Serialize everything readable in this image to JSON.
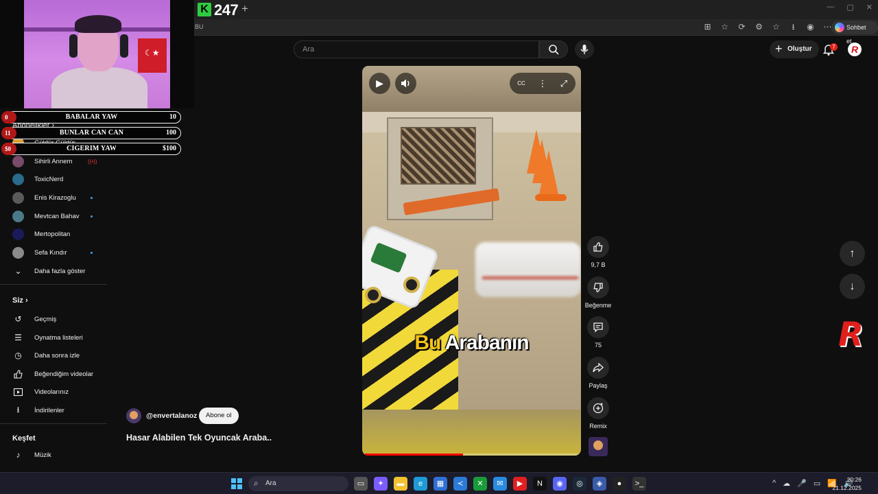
{
  "browser": {
    "tab_logo": "K",
    "tab_title": "247",
    "tab_plus": "+",
    "address_fragment": "BU",
    "chat_button": "Sohbet et",
    "window_controls": [
      "—",
      "▢",
      "✕"
    ],
    "toolbar_icons": [
      "⊞",
      "☆",
      "⟳",
      "⚙",
      "☆",
      "⭳",
      "◉",
      "⋯"
    ]
  },
  "webcam": {
    "description_hidden": ""
  },
  "scoreboard": [
    {
      "index": "0",
      "label": "BABALAR YAW",
      "value": "10"
    },
    {
      "index": "11",
      "label": "BUNLAR CAN CAN",
      "value": "100"
    },
    {
      "index": "$0",
      "label": "CIGERIM YAW",
      "value": "$100"
    }
  ],
  "header": {
    "search_placeholder": "Ara",
    "search_icon": "search-icon",
    "mic_icon": "mic-icon",
    "create_label": "Oluştur",
    "notification_count": "7",
    "avatar_letter": "R"
  },
  "sidebar": {
    "subscriptions_heading": "Abonelikler",
    "subscriptions": [
      {
        "name": "Güldür Güldür",
        "color": "#d8a03a",
        "indicator": ""
      },
      {
        "name": "Sihirli Annem",
        "color": "#7a4a6a",
        "indicator": "live"
      },
      {
        "name": "ToxicNerd",
        "color": "#2a6a8a",
        "indicator": ""
      },
      {
        "name": "Enis Kirazoglu",
        "color": "#5a5a5a",
        "indicator": "dot"
      },
      {
        "name": "Mevtcan Bahav",
        "color": "#4a7a8a",
        "indicator": "dot"
      },
      {
        "name": "Mertopolitan",
        "color": "#1a1a5a",
        "indicator": ""
      },
      {
        "name": "Sefa Kındır",
        "color": "#8a8a8a",
        "indicator": "dot"
      }
    ],
    "show_more": "Daha fazla göster",
    "you_heading": "Siz",
    "you_items": [
      {
        "label": "Geçmiş",
        "icon": "history-icon",
        "glyph": "↺"
      },
      {
        "label": "Oynatma listeleri",
        "icon": "playlist-icon",
        "glyph": "☰"
      },
      {
        "label": "Daha sonra izle",
        "icon": "clock-icon",
        "glyph": "◷"
      },
      {
        "label": "Beğendiğim videolar",
        "icon": "thumbs-up-icon",
        "glyph": "👍"
      },
      {
        "label": "Videolarınız",
        "icon": "video-icon",
        "glyph": "▶"
      },
      {
        "label": "İndirilenler",
        "icon": "download-icon",
        "glyph": "⭳"
      }
    ],
    "explore_heading": "Keşfet",
    "explore_items": [
      {
        "label": "Müzik",
        "icon": "music-icon",
        "glyph": "♪"
      }
    ]
  },
  "video": {
    "caption_highlight": "Bu",
    "caption_rest": "Arabanın",
    "progress": 0.46,
    "play_glyph": "▶",
    "volume_glyph": "🔊",
    "cc_glyph": "CC",
    "more_glyph": "⋮",
    "fullscreen_glyph": "⤢"
  },
  "actions": {
    "like_count": "9,7 B",
    "dislike_label": "Beğenme",
    "comment_count": "75",
    "share_label": "Paylaş",
    "remix_label": "Remix"
  },
  "channel": {
    "handle": "@envertalanoz",
    "subscribe_label": "Abone ol",
    "video_title": "Hasar Alabilen Tek Oyuncak Araba.."
  },
  "nav": {
    "up_glyph": "↑",
    "down_glyph": "↓"
  },
  "brand_letter": "R",
  "taskbar": {
    "search_placeholder": "Ara",
    "apps": [
      {
        "name": "task-view",
        "color": "#555",
        "glyph": "▭"
      },
      {
        "name": "copilot",
        "color": "#7a5cff",
        "glyph": "✦"
      },
      {
        "name": "file-explorer",
        "color": "#f2c230",
        "glyph": "▬"
      },
      {
        "name": "edge",
        "color": "#1e9ad6",
        "glyph": "e"
      },
      {
        "name": "store",
        "color": "#2f6fd6",
        "glyph": "▦"
      },
      {
        "name": "vs-code",
        "color": "#2b7bd6",
        "glyph": "≺"
      },
      {
        "name": "xbox",
        "color": "#1a9a3a",
        "glyph": "✕"
      },
      {
        "name": "mail",
        "color": "#2a8ae0",
        "glyph": "✉"
      },
      {
        "name": "youtube",
        "color": "#e02020",
        "glyph": "▶"
      },
      {
        "name": "netflix",
        "color": "#111",
        "glyph": "N"
      },
      {
        "name": "discord",
        "color": "#5865f2",
        "glyph": "◉"
      },
      {
        "name": "steam",
        "color": "#1b2838",
        "glyph": "◎"
      },
      {
        "name": "bot",
        "color": "#3a5aaa",
        "glyph": "◈"
      },
      {
        "name": "obs",
        "color": "#222",
        "glyph": "●"
      },
      {
        "name": "terminal",
        "color": "#333",
        "glyph": ">_"
      }
    ],
    "tray": [
      "^",
      "☁",
      "🎤",
      "▭",
      "📶",
      "🔊"
    ],
    "time": "20:26",
    "date": "21.12.2025"
  }
}
